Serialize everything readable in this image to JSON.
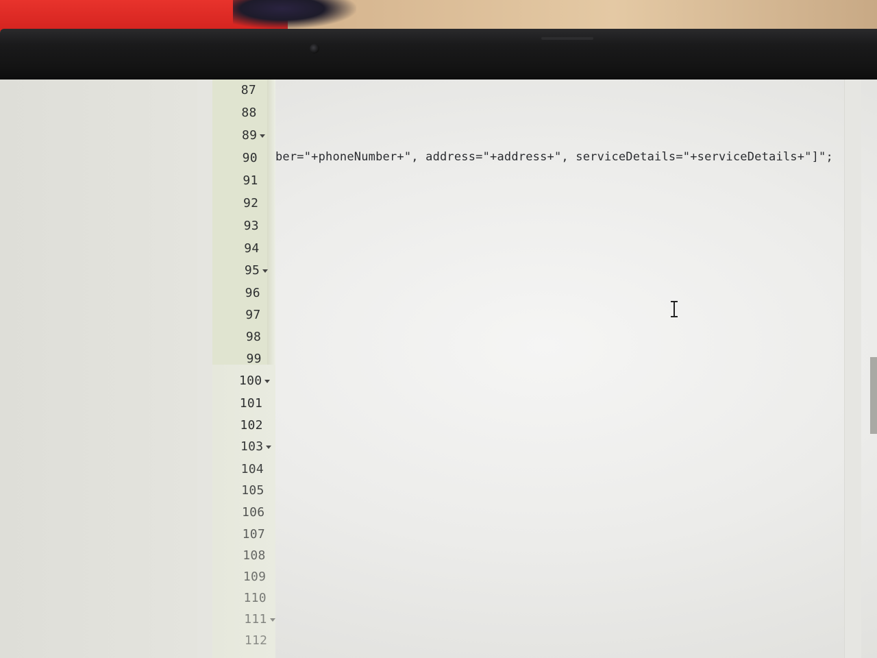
{
  "editor": {
    "line_numbers": [
      "87",
      "88",
      "89",
      "90",
      "91",
      "92",
      "93",
      "94",
      "95",
      "96",
      "97",
      "98",
      "99",
      "100",
      "101",
      "102",
      "103",
      "104",
      "105",
      "106",
      "107",
      "108",
      "109",
      "110",
      "111",
      "112"
    ],
    "fold_lines": [
      "89",
      "95",
      "100",
      "103",
      "111"
    ],
    "code_line_90": "ber=\"+phoneNumber+\", address=\"+address+\", serviceDetails=\"+serviceDetails+\"]\";"
  },
  "cursor": {
    "type": "text-cursor-icon"
  }
}
